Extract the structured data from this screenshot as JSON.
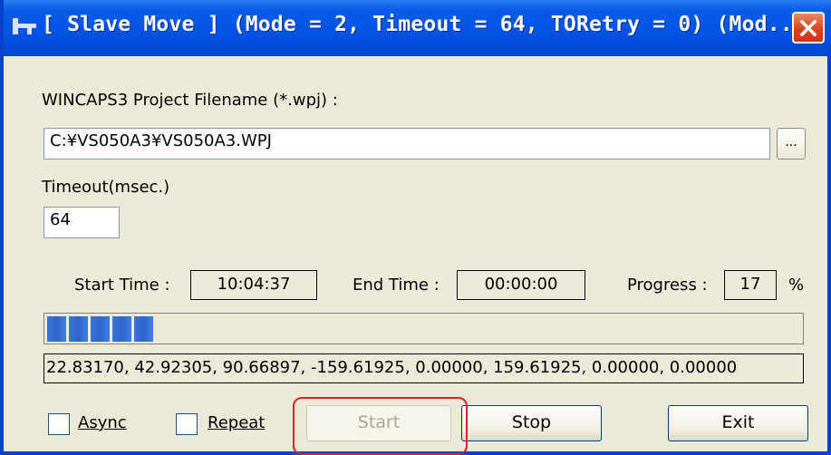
{
  "window": {
    "title": "[ Slave Move ] (Mode = 2, Timeout = 64, TORetry = 0) (Mod..."
  },
  "project": {
    "label": "WINCAPS3 Project Filename (*.wpj) :",
    "value": "C:¥VS050A3¥VS050A3.WPJ",
    "browse_label": "..."
  },
  "timeout": {
    "label": "Timeout(msec.)",
    "value": "64"
  },
  "status": {
    "start_time_label": "Start Time :",
    "start_time": "10:04:37",
    "end_time_label": "End Time :",
    "end_time": "00:00:00",
    "progress_label": "Progress :",
    "progress": "17",
    "percent_sign": "%"
  },
  "progress_fraction": 0.17,
  "coordinates": "22.83170, 42.92305, 90.66897, -159.61925, 0.00000, 159.61925, 0.00000, 0.00000",
  "options": {
    "async_label": "Async",
    "repeat_label": "Repeat"
  },
  "buttons": {
    "start": "Start",
    "stop": "Stop",
    "exit": "Exit"
  },
  "colors": {
    "titlebar": "#0551e0",
    "progress_block": "#2f63c8",
    "highlight": "#e0202a"
  }
}
